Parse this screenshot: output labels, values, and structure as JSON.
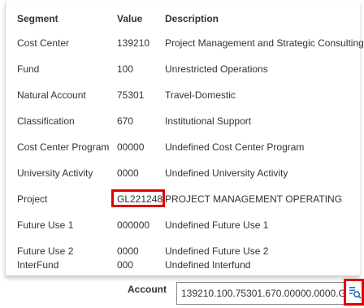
{
  "top_clipped_text": "",
  "table": {
    "headers": [
      "Segment",
      "Value",
      "Description"
    ],
    "rows": [
      {
        "segment": "Cost Center",
        "value": "139210",
        "description": "Project Management and Strategic Consulting"
      },
      {
        "segment": "Fund",
        "value": "100",
        "description": "Unrestricted Operations"
      },
      {
        "segment": "Natural Account",
        "value": "75301",
        "description": "Travel-Domestic"
      },
      {
        "segment": "Classification",
        "value": "670",
        "description": "Institutional Support"
      },
      {
        "segment": "Cost Center Program",
        "value": "00000",
        "description": "Undefined Cost Center Program"
      },
      {
        "segment": "University Activity",
        "value": "0000",
        "description": "Undefined University Activity"
      },
      {
        "segment": "Project",
        "value": "GL221248",
        "description": "PROJECT MANAGEMENT OPERATING"
      },
      {
        "segment": "Future Use 1",
        "value": "000000",
        "description": "Undefined Future Use 1"
      },
      {
        "segment": "Future Use 2",
        "value": "0000",
        "description": "Undefined Future Use 2"
      },
      {
        "segment": "InterFund",
        "value": "000",
        "description": "Undefined Interfund"
      }
    ]
  },
  "account": {
    "label": "Account",
    "value": "139210.100.75301.670.00000.0000.GL"
  },
  "icons": {
    "search": "search-list-icon"
  },
  "colors": {
    "highlight": "#e00000",
    "icon_blue": "#2a6ebb"
  }
}
